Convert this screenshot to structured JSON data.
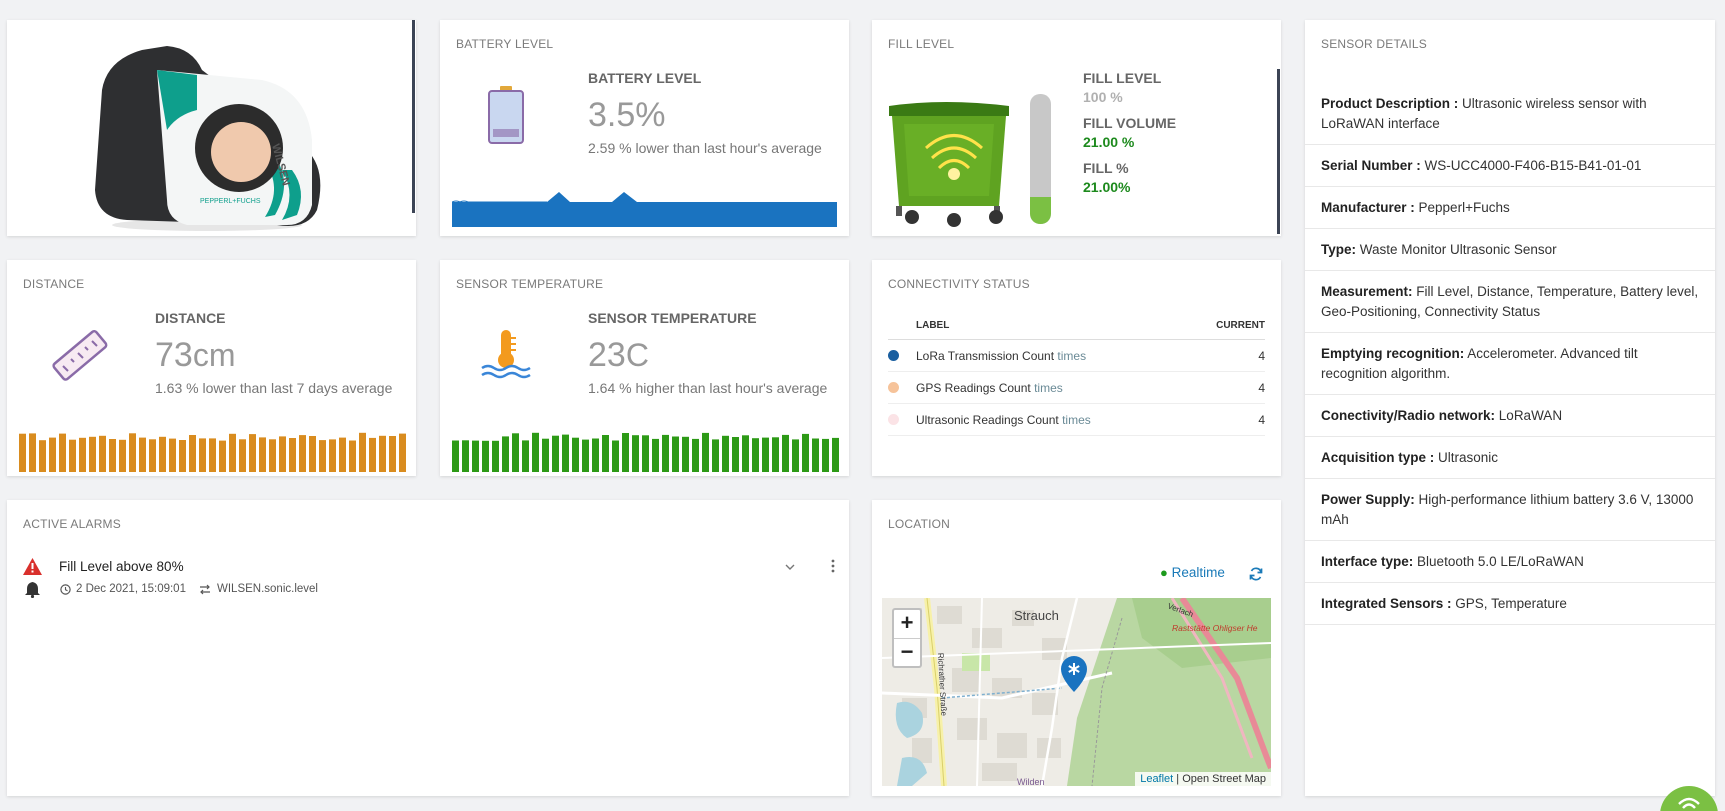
{
  "product_card": {
    "device_brand": "WILSEN",
    "maker_logo": "PEPPERL+FUCHS"
  },
  "battery": {
    "card_title": "BATTERY LEVEL",
    "label": "BATTERY LEVEL",
    "value": "3.5%",
    "subtitle": "2.59 % lower than last hour's average",
    "icon": "battery-icon",
    "color": "#1a73c0"
  },
  "fill": {
    "card_title": "FILL LEVEL",
    "fill_level_label": "FILL LEVEL",
    "fill_level_value": "100 %",
    "fill_volume_label": "FILL VOLUME",
    "fill_volume_value": "21.00 %",
    "fill_pct_label": "FILL %",
    "fill_pct_value": "21.00%",
    "gauge_fraction": 0.21,
    "value_color": "#1d8a1d"
  },
  "sensor_details": {
    "card_title": "SENSOR DETAILS",
    "rows": [
      {
        "label": "Product Description :",
        "value": "Ultrasonic wireless sensor with LoRaWAN interface"
      },
      {
        "label": "Serial Number :",
        "value": "WS-UCC4000-F406-B15-B41-01-01"
      },
      {
        "label": "Manufacturer :",
        "value": "Pepperl+Fuchs"
      },
      {
        "label": "Type:",
        "value": "Waste Monitor Ultrasonic Sensor"
      },
      {
        "label": "Measurement:",
        "value": "Fill Level, Distance, Temperature, Battery level, Geo-Positioning, Connectivity Status"
      },
      {
        "label": "Emptying recognition:",
        "value": "Accelerometer. Advanced tilt recognition algorithm."
      },
      {
        "label": "Conectivity/Radio network:",
        "value": "LoRaWAN"
      },
      {
        "label": "Acquisition type :",
        "value": "Ultrasonic"
      },
      {
        "label": "Power Supply:",
        "value": "High-performance lithium battery 3.6 V, 13000 mAh"
      },
      {
        "label": "Interface type:",
        "value": "Bluetooth 5.0 LE/LoRaWAN"
      },
      {
        "label": "Integrated Sensors :",
        "value": "GPS, Temperature"
      }
    ]
  },
  "distance": {
    "card_title": "DISTANCE",
    "label": "DISTANCE",
    "value_number": "73",
    "value_unit": "cm",
    "subtitle": "1.63 % lower than last 7 days average",
    "icon": "ruler-icon",
    "color": "#d98c1f"
  },
  "temperature": {
    "card_title": "SENSOR TEMPERATURE",
    "label": "SENSOR TEMPERATURE",
    "value_number": "23",
    "value_unit": "C",
    "subtitle": "1.64 % higher than last hour's average",
    "icon": "thermometer-icon",
    "color": "#2d9a16"
  },
  "connectivity": {
    "card_title": "CONNECTIVITY STATUS",
    "col_label": "LABEL",
    "col_current": "CURRENT",
    "rows": [
      {
        "label": "LoRa Transmission Count",
        "unit": "times",
        "value": "4",
        "color": "#1a5fa0"
      },
      {
        "label": "GPS Readings Count",
        "unit": "times",
        "value": "4",
        "color": "#f6c39a"
      },
      {
        "label": "Ultrasonic Readings Count",
        "unit": "times",
        "value": "4",
        "color": "#fbe3e6"
      }
    ]
  },
  "alarms": {
    "card_title": "ACTIVE ALARMS",
    "items": [
      {
        "title": "Fill Level above 80%",
        "time": "2 Dec 2021, 15:09:01",
        "source": "WILSEN.sonic.level",
        "severity_color": "#d9302c"
      }
    ]
  },
  "location": {
    "card_title": "LOCATION",
    "realtime_label": "Realtime",
    "zoom_in": "+",
    "zoom_out": "−",
    "attribution_leaflet": "Leaflet",
    "attribution_sep": "|",
    "attribution_osm": "Open Street Map",
    "map_labels": {
      "place": "Strauch",
      "street": "Richrather Straße",
      "road": "Raststätte Ohligser He",
      "road2": "Verlach",
      "district": "Wilden"
    }
  }
}
